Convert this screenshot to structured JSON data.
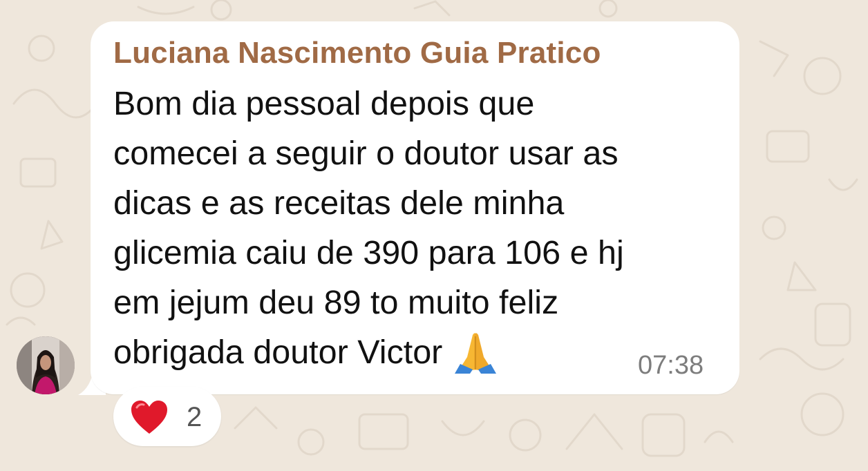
{
  "chat": {
    "message": {
      "sender_name": "Luciana Nascimento Guia Pratico",
      "text": "Bom dia pessoal depois que\ncomecei a seguir o doutor usar as\ndicas e as receitas dele minha\nglicemia caiu de 390 para 106 e hj\nem jejum deu 89 to muito feliz\nobrigada doutor Victor",
      "emoji": "folded-hands",
      "time": "07:38"
    },
    "reaction": {
      "emoji": "red-heart",
      "count": "2"
    }
  },
  "colors": {
    "background": "#efe7dc",
    "bubble": "#ffffff",
    "sender_name": "#a06a45",
    "timestamp": "#7d7d7d"
  }
}
